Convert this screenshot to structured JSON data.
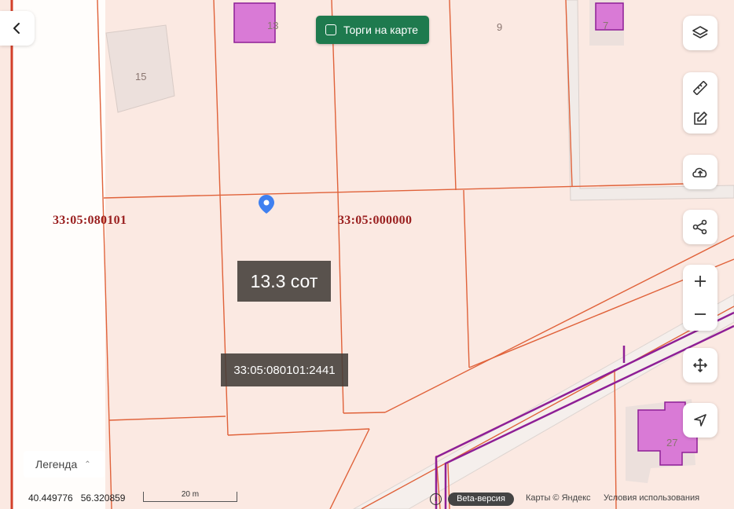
{
  "map": {
    "house_numbers": {
      "h13": "13",
      "h9": "9",
      "h7": "7",
      "h15": "15",
      "h27": "27"
    },
    "quarter_labels": {
      "left": "33:05:080101",
      "right": "33:05:000000"
    }
  },
  "parcel": {
    "area": "13.3 сот",
    "cadastral_number": "33:05:080101:2441"
  },
  "toolbar": {
    "torgi_label": "Торги на карте"
  },
  "controls": {
    "icons": [
      "back-icon",
      "layers-icon",
      "ruler-icon",
      "edit-icon",
      "cloud-upload-icon",
      "share-icon",
      "zoom-in-icon",
      "zoom-out-icon",
      "move-icon",
      "locate-icon"
    ]
  },
  "legend": {
    "label": "Легенда"
  },
  "footer": {
    "longitude": "40.449776",
    "latitude": "56.320859",
    "scale": "20 m",
    "info": "i",
    "beta": "Beta-версия",
    "copyright": "Карты © Яндекс",
    "terms": "Условия использования"
  },
  "colors": {
    "parcel_line": "#e0623a",
    "highway": "#8e1f96",
    "building": "#d97ad6",
    "torgi_bg": "#1e7a4e"
  }
}
